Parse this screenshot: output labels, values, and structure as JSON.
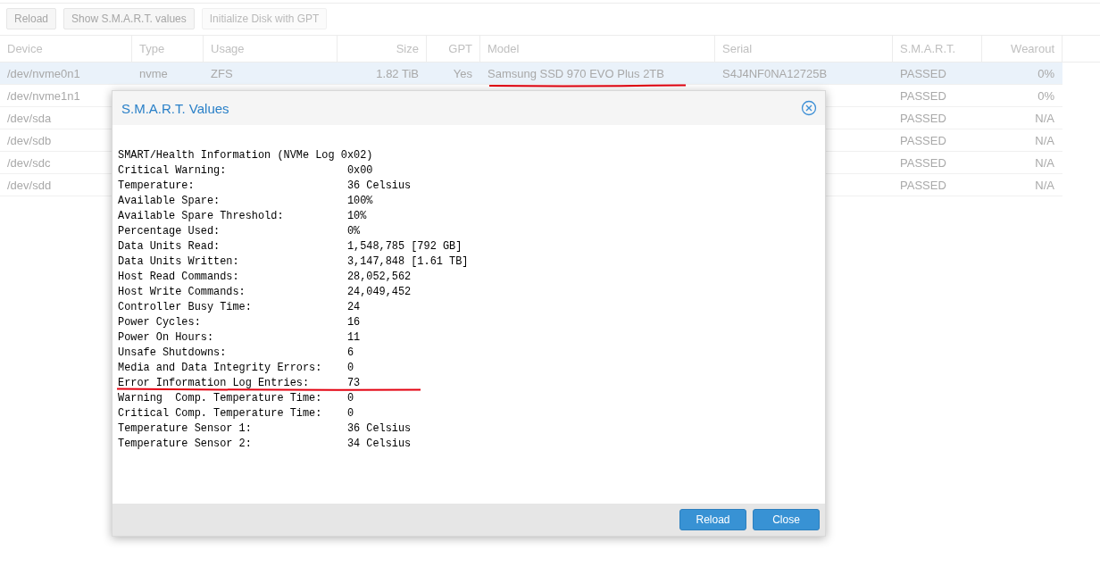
{
  "toolbar": [
    {
      "label": "Reload",
      "disabled": false
    },
    {
      "label": "Show S.M.A.R.T. values",
      "disabled": false
    },
    {
      "label": "Initialize Disk with GPT",
      "disabled": true
    }
  ],
  "table": {
    "columns": [
      "Device",
      "Type",
      "Usage",
      "Size",
      "GPT",
      "Model",
      "Serial",
      "S.M.A.R.T.",
      "Wearout"
    ],
    "rows": [
      {
        "selected": true,
        "cells": {
          "device": "/dev/nvme0n1",
          "type": "nvme",
          "usage": "ZFS",
          "size": "1.82 TiB",
          "gpt": "Yes",
          "model": "Samsung SSD 970 EVO Plus 2TB",
          "serial": "S4J4NF0NA12725B",
          "smart": "PASSED",
          "wearout": "0%"
        }
      },
      {
        "selected": false,
        "cells": {
          "device": "/dev/nvme1n1",
          "smart": "PASSED",
          "wearout": "0%"
        }
      },
      {
        "selected": false,
        "cells": {
          "device": "/dev/sda",
          "smart": "PASSED",
          "wearout": "N/A"
        }
      },
      {
        "selected": false,
        "cells": {
          "device": "/dev/sdb",
          "smart": "PASSED",
          "wearout": "N/A"
        }
      },
      {
        "selected": false,
        "cells": {
          "device": "/dev/sdc",
          "smart": "PASSED",
          "wearout": "N/A"
        }
      },
      {
        "selected": false,
        "cells": {
          "device": "/dev/sdd",
          "smart": "PASSED",
          "wearout": "N/A"
        }
      }
    ]
  },
  "dialog": {
    "title": "S.M.A.R.T. Values",
    "lines": [
      "SMART/Health Information (NVMe Log 0x02)",
      "Critical Warning:                   0x00",
      "Temperature:                        36 Celsius",
      "Available Spare:                    100%",
      "Available Spare Threshold:          10%",
      "Percentage Used:                    0%",
      "Data Units Read:                    1,548,785 [792 GB]",
      "Data Units Written:                 3,147,848 [1.61 TB]",
      "Host Read Commands:                 28,052,562",
      "Host Write Commands:                24,049,452",
      "Controller Busy Time:               24",
      "Power Cycles:                       16",
      "Power On Hours:                     11",
      "Unsafe Shutdowns:                   6",
      "Media and Data Integrity Errors:    0",
      "Error Information Log Entries:      73",
      "Warning  Comp. Temperature Time:    0",
      "Critical Comp. Temperature Time:    0",
      "Temperature Sensor 1:               36 Celsius",
      "Temperature Sensor 2:               34 Celsius"
    ],
    "buttons": [
      "Reload",
      "Close"
    ]
  }
}
